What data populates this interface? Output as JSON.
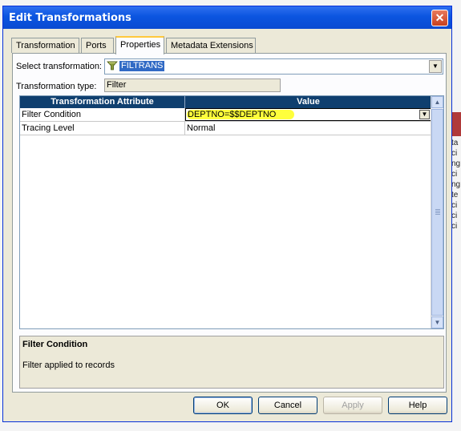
{
  "window": {
    "title": "Edit Transformations",
    "close_glyph": "✕"
  },
  "tabs": [
    {
      "label": "Transformation"
    },
    {
      "label": "Ports"
    },
    {
      "label": "Properties",
      "active": true
    },
    {
      "label": "Metadata Extensions"
    }
  ],
  "form": {
    "select_label": "Select transformation:",
    "select_value": "FILTRANS",
    "select_icon": "filter-funnel-icon",
    "type_label": "Transformation type:",
    "type_value": "Filter"
  },
  "grid": {
    "columns": [
      "Transformation Attribute",
      "Value"
    ],
    "rows": [
      {
        "attribute": "Filter Condition",
        "value": "DEPTNO=$$DEPTNO"
      },
      {
        "attribute": "Tracing Level",
        "value": "Normal"
      }
    ],
    "highlight_color": "#ffff3c",
    "header_color": "#0f3f6f"
  },
  "description": {
    "title": "Filter Condition",
    "text": "Filter applied to records"
  },
  "buttons": {
    "ok": "OK",
    "cancel": "Cancel",
    "apply": "Apply",
    "help": "Help"
  },
  "background": {
    "letters": [
      "ta",
      "ci",
      "ng",
      "ci",
      "ng",
      "te",
      "ci",
      "ci",
      "ci"
    ]
  },
  "colors": {
    "titlebar": "#0b55e0",
    "selection": "#316ac5",
    "window": "#ece9d8"
  }
}
